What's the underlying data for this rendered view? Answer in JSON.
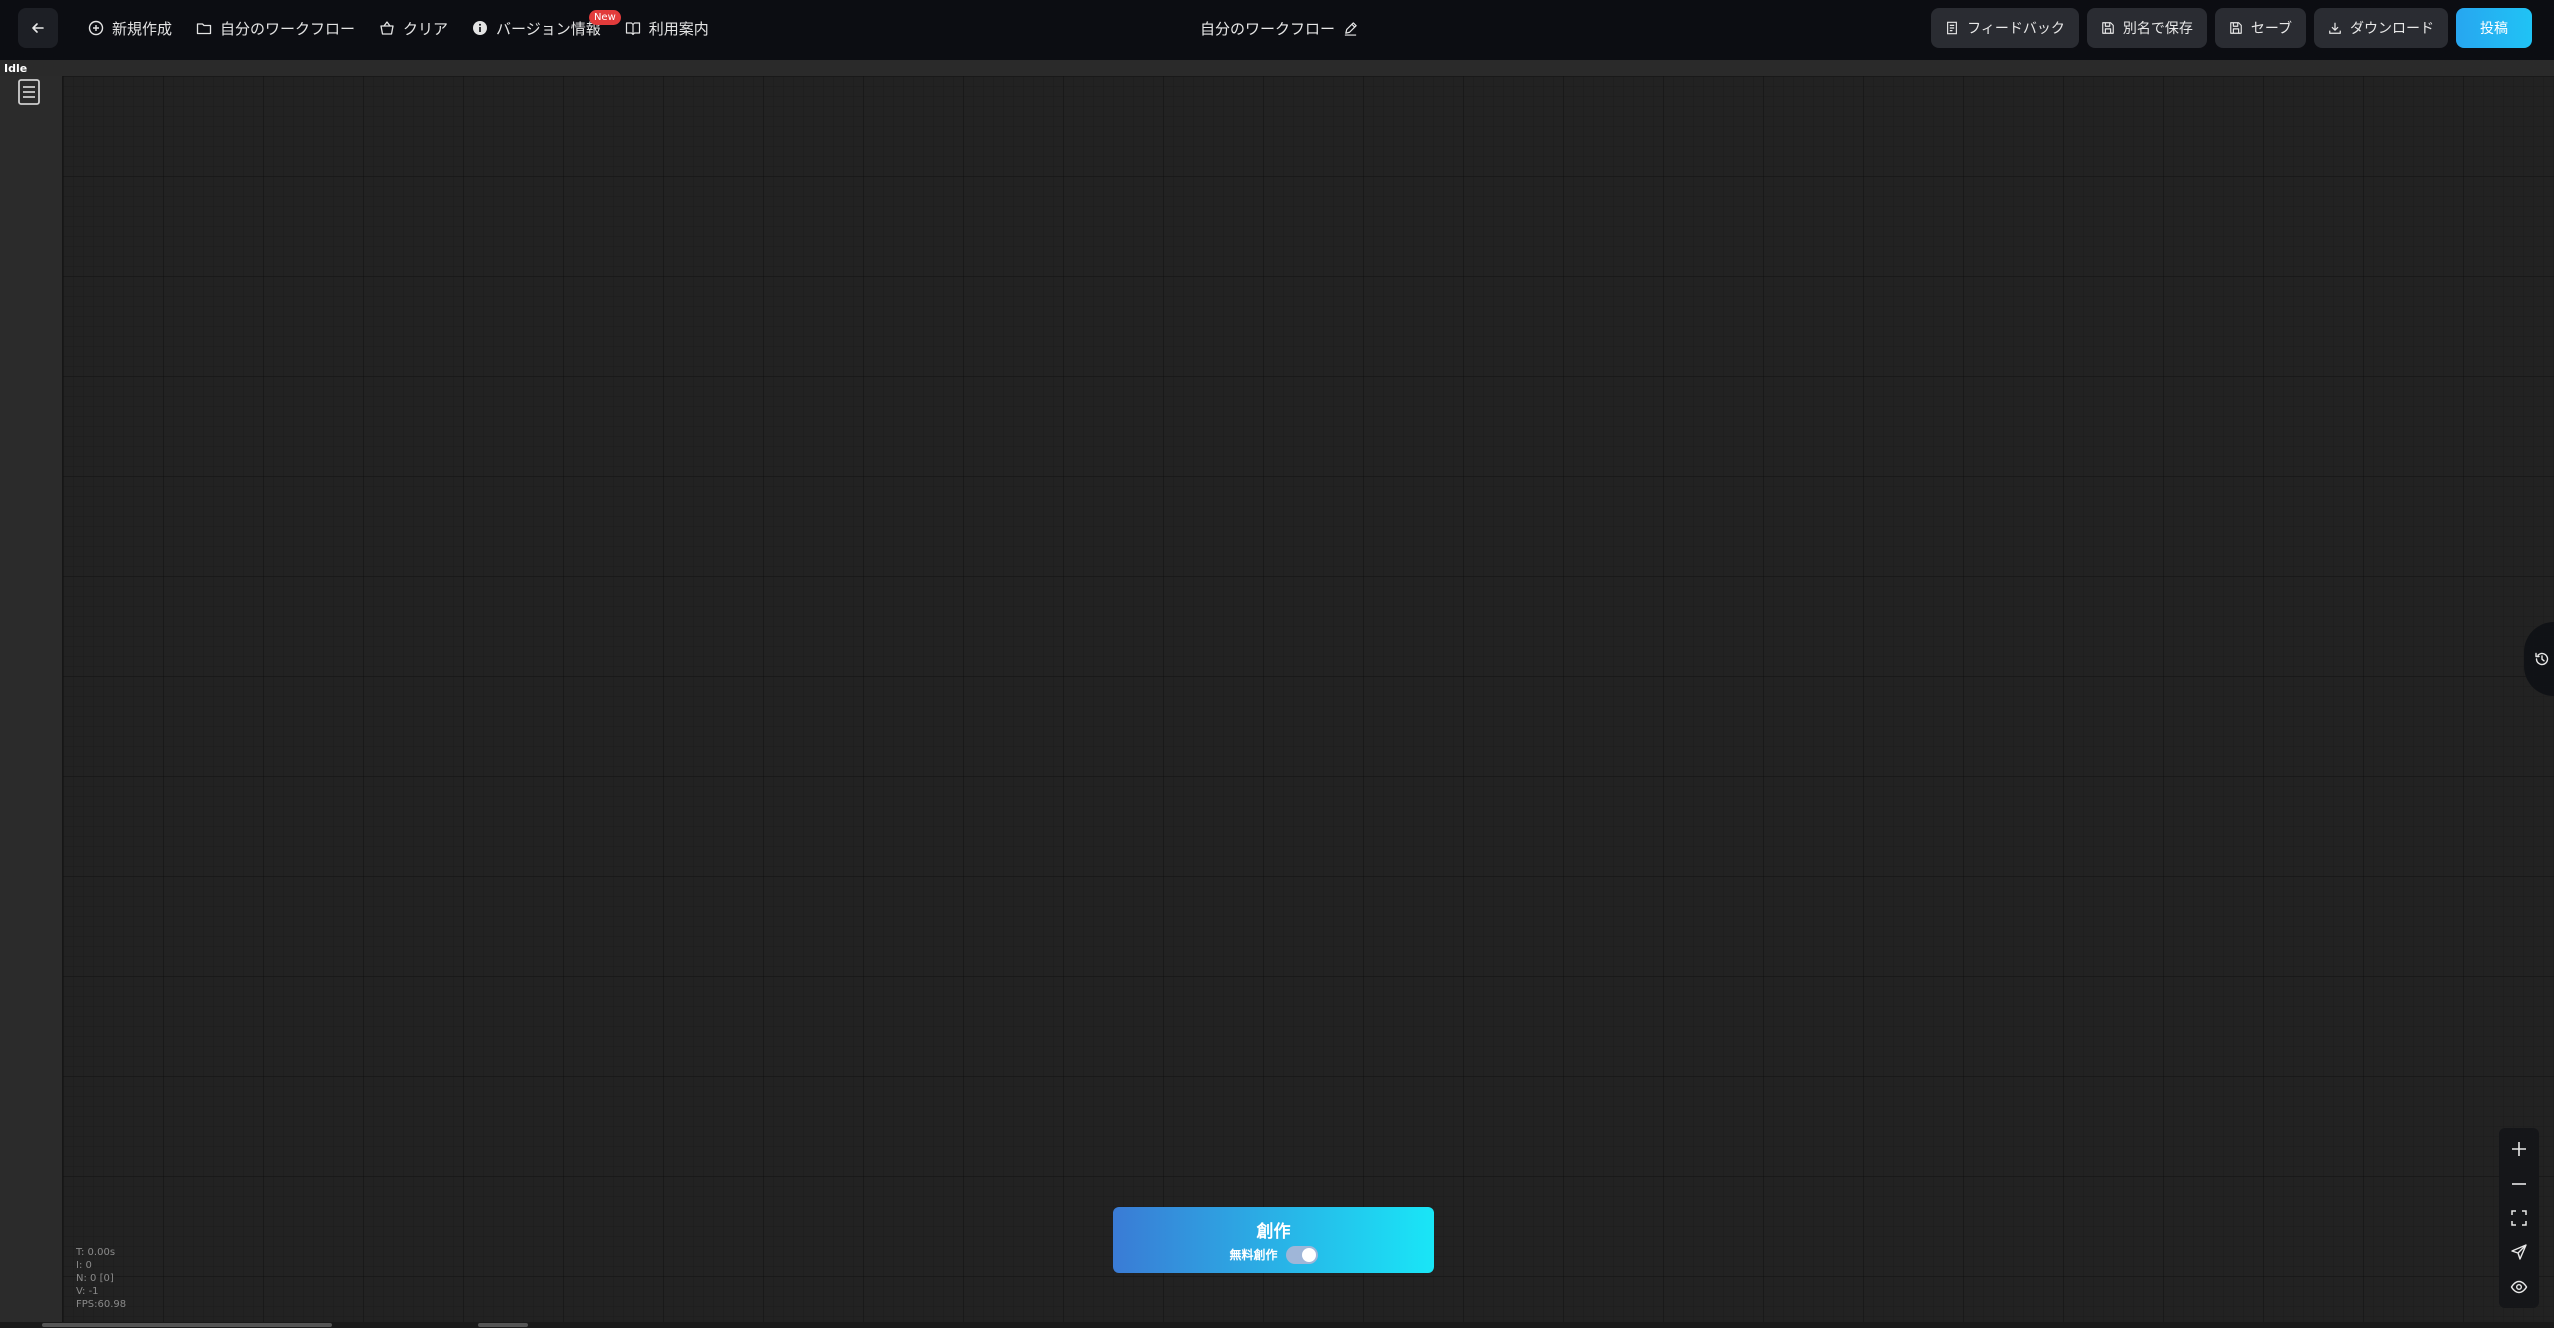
{
  "status": "Idle",
  "menu": {
    "new": "新規作成",
    "my_workflows": "自分のワークフロー",
    "clear": "クリア",
    "version_info": "バージョン情報",
    "new_badge": "New",
    "guide": "利用案内"
  },
  "workflow_title": "自分のワークフロー",
  "actions": {
    "feedback": "フィードバック",
    "save_as": "別名で保存",
    "save": "セーブ",
    "download": "ダウンロード",
    "post": "投稿"
  },
  "create": {
    "label": "創作",
    "free_label": "無料創作",
    "free_enabled": true
  },
  "stats": {
    "t": "T: 0.00s",
    "i": "I: 0",
    "n": "N: 0 [0]",
    "v": "V: -1",
    "fps": "FPS:60.98"
  },
  "colors": {
    "accent": "#20c3f5",
    "badge": "#e23b3b"
  }
}
